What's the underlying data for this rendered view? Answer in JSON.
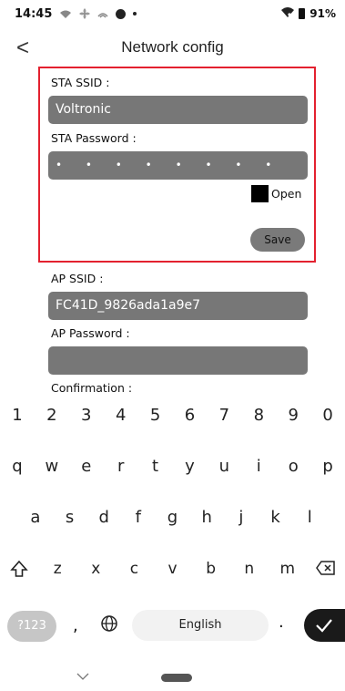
{
  "status_bar": {
    "time": "14:45",
    "battery": "91%",
    "icons": [
      "wifi-calling-icon",
      "fan-icon",
      "signal-icon",
      "circle-icon",
      "dot-icon"
    ]
  },
  "header": {
    "title": "Network config",
    "back_label": "<"
  },
  "sta": {
    "ssid_label": "STA SSID :",
    "ssid_value": "Voltronic",
    "password_label": "STA Password :",
    "password_value": "• • • • • • • • • • • • • • • •",
    "open_label": "Open",
    "save_label": "Save",
    "highlight_color": "#e3212f"
  },
  "ap": {
    "ssid_label": "AP SSID :",
    "ssid_value": "FC41D_9826ada1a9e7",
    "password_label": "AP Password :",
    "password_value": "",
    "confirmation_label": "Confirmation :"
  },
  "keyboard": {
    "number_row": [
      "1",
      "2",
      "3",
      "4",
      "5",
      "6",
      "7",
      "8",
      "9",
      "0"
    ],
    "row_q": [
      "q",
      "w",
      "e",
      "r",
      "t",
      "y",
      "u",
      "i",
      "o",
      "p"
    ],
    "row_a": [
      "a",
      "s",
      "d",
      "f",
      "g",
      "h",
      "j",
      "k",
      "l"
    ],
    "row_z": [
      "z",
      "x",
      "c",
      "v",
      "b",
      "n",
      "m"
    ],
    "symbols_label": "?123",
    "comma_label": ",",
    "space_label": "English",
    "period_label": "."
  },
  "colors": {
    "field_bg": "#777777",
    "enter_key": "#1a1a1a"
  }
}
